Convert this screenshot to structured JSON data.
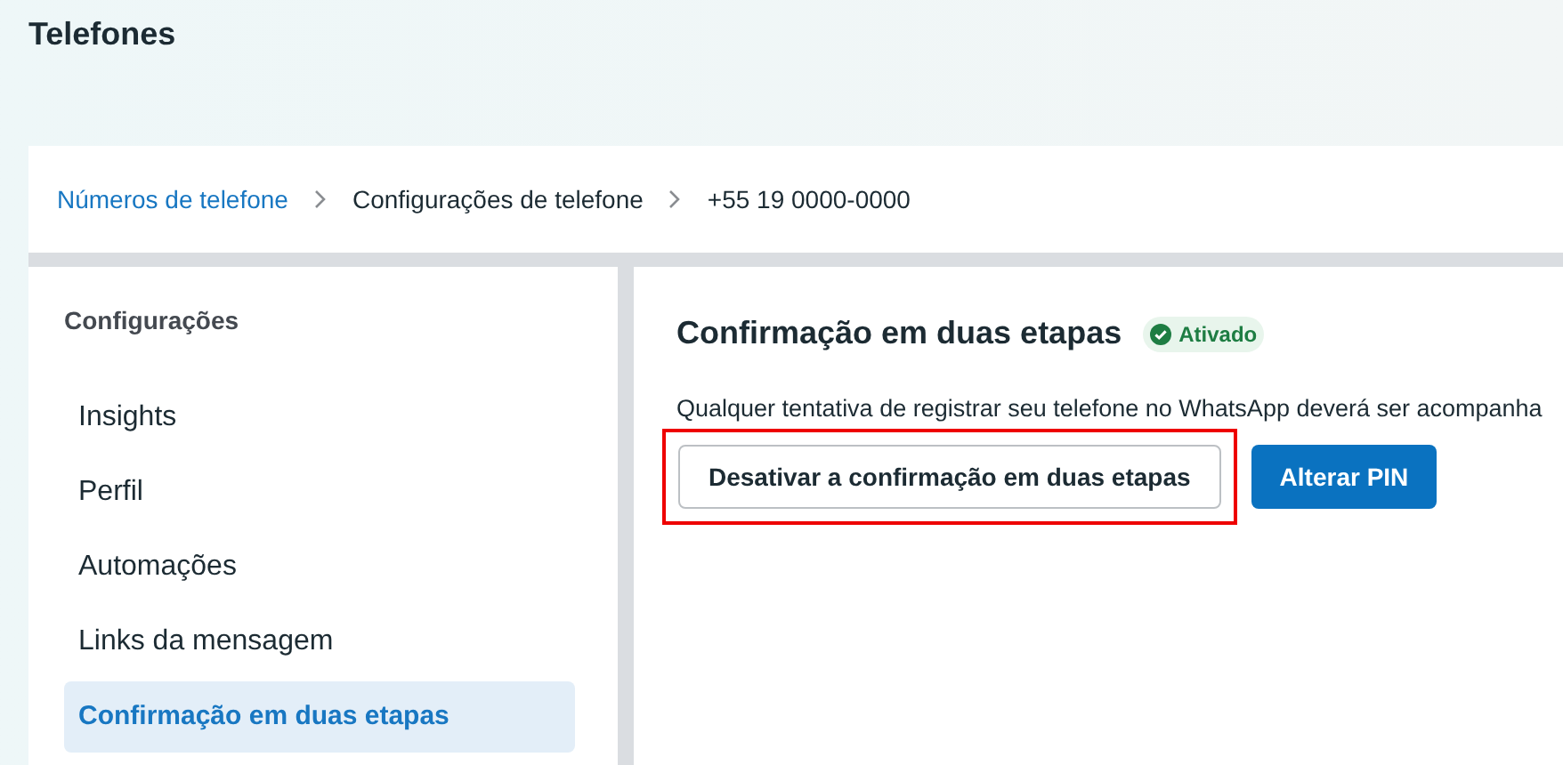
{
  "page_title": "Telefones",
  "breadcrumb": [
    {
      "label": "Números de telefone",
      "kind": "link"
    },
    {
      "label": "Configurações de telefone",
      "kind": "text"
    },
    {
      "label": "+55 19 0000-0000",
      "kind": "text"
    }
  ],
  "sidebar": {
    "title": "Configurações",
    "items": [
      {
        "label": "Insights",
        "selected": false
      },
      {
        "label": "Perfil",
        "selected": false
      },
      {
        "label": "Automações",
        "selected": false
      },
      {
        "label": "Links da mensagem",
        "selected": false
      },
      {
        "label": "Confirmação em duas etapas",
        "selected": true
      }
    ]
  },
  "section": {
    "title": "Confirmação em duas etapas",
    "status": "Ativado",
    "description": "Qualquer tentativa de registrar seu telefone no WhatsApp deverá ser acompanha",
    "buttons": [
      {
        "label": "Desativar a confirmação em duas etapas",
        "kind": "secondary",
        "highlighted": true
      },
      {
        "label": "Alterar PIN",
        "kind": "primary",
        "highlighted": false
      }
    ]
  }
}
